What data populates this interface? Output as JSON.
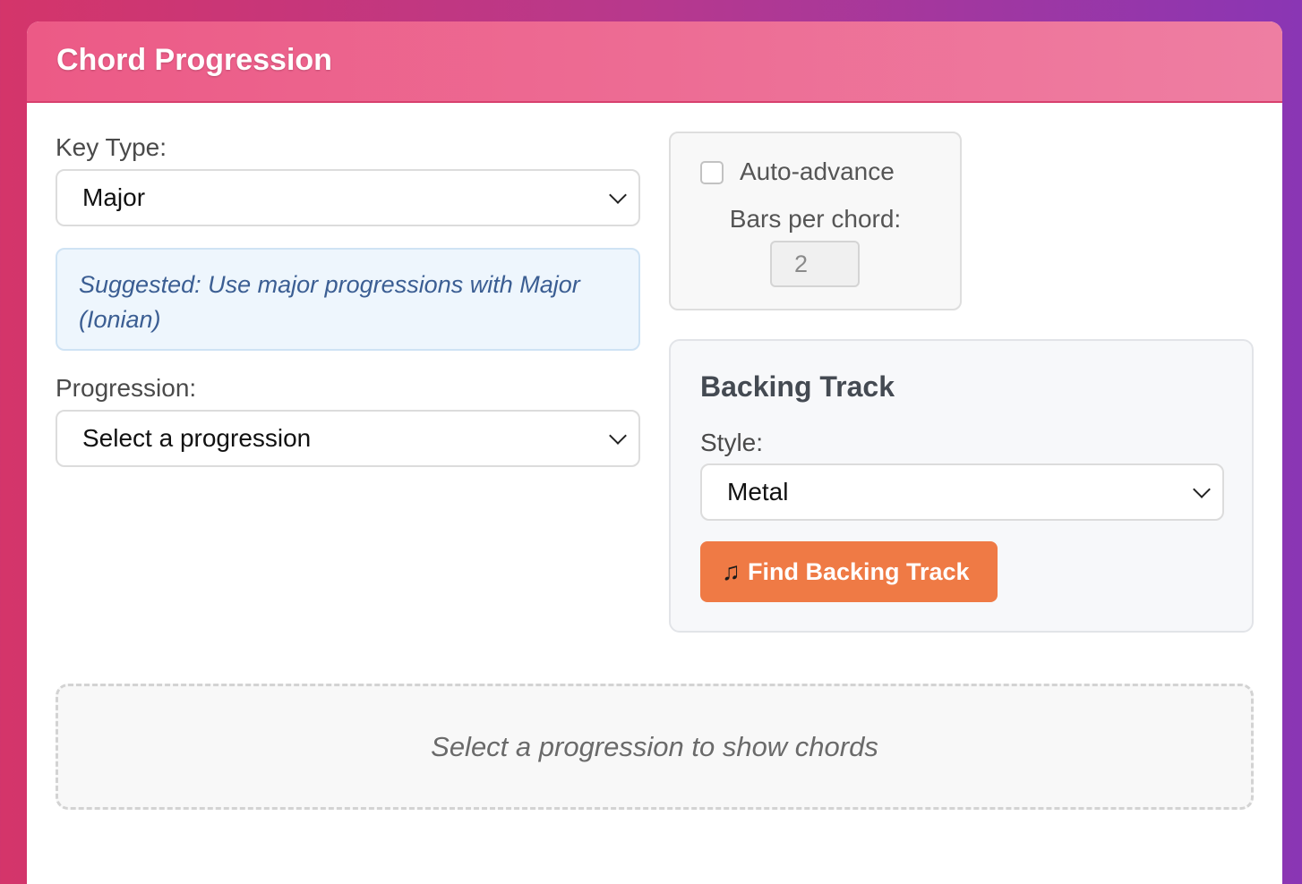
{
  "panel": {
    "title": "Chord Progression"
  },
  "key_type": {
    "label": "Key Type:",
    "selected": "Major"
  },
  "hint": {
    "text": "Suggested: Use major progressions with Major (Ionian)"
  },
  "progression": {
    "label": "Progression:",
    "selected": "Select a progression"
  },
  "auto_advance": {
    "label": "Auto-advance",
    "checked": false,
    "bars_label": "Bars per chord:",
    "bars_value": "2"
  },
  "backing_track": {
    "title": "Backing Track",
    "style_label": "Style:",
    "style_selected": "Metal",
    "button_icon": "music-note-icon",
    "button_label": "Find Backing Track"
  },
  "chords": {
    "placeholder": "Select a progression to show chords"
  },
  "colors": {
    "header": "#ec5a86",
    "button": "#ef7a45",
    "hint_bg": "#eef6fd",
    "hint_text": "#3b5e93"
  }
}
